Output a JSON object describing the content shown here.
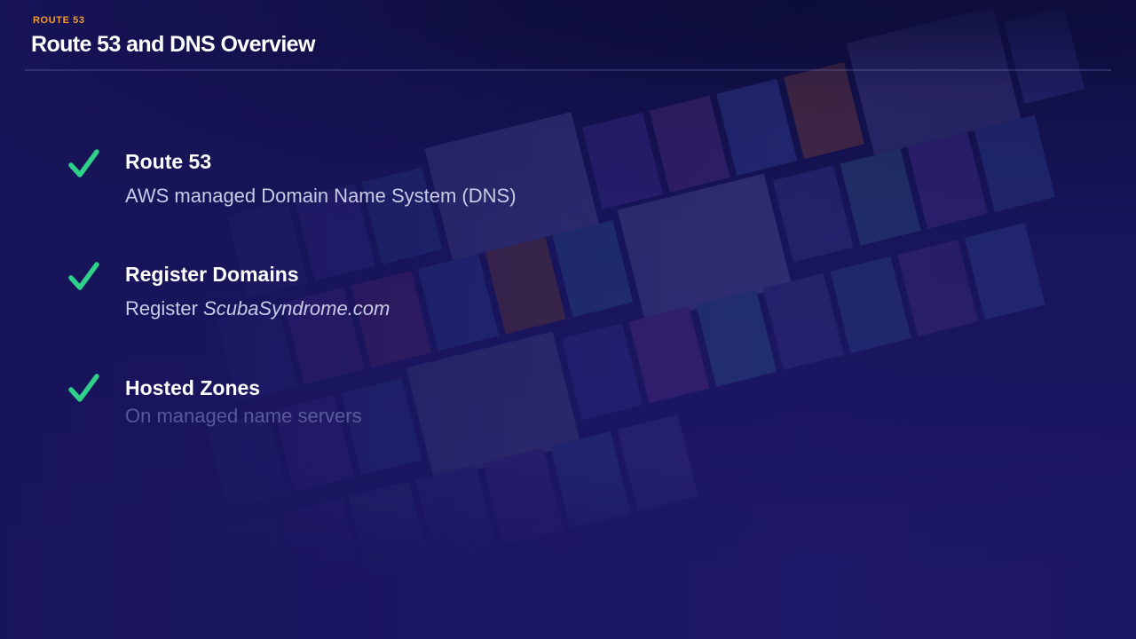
{
  "header": {
    "kicker": "ROUTE 53",
    "title": "Route 53 and DNS Overview"
  },
  "items": [
    {
      "icon": "check-icon",
      "title": "Route 53",
      "subtitle": "AWS managed Domain Name System (DNS)"
    },
    {
      "icon": "check-icon",
      "title": "Register Domains",
      "subtitle_prefix": "Register ",
      "subtitle_emphasis": "ScubaSyndrome.com"
    },
    {
      "icon": "check-icon",
      "title": "Hosted Zones",
      "subtitle": "On managed name servers"
    }
  ],
  "colors": {
    "accent_orange": "#f39a2e",
    "check_green": "#2fd08a",
    "background": "#1d1766"
  }
}
